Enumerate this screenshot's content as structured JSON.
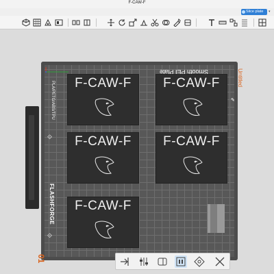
{
  "window": {
    "title": "F-CAW-F"
  },
  "menubar": {
    "slice_label": "Slice plate"
  },
  "plate": {
    "name": "Smooth PEI Plate",
    "material_label": "PLA/PETG/ABS/TPU",
    "brand": "FLASHFORGE",
    "project_name": "Untitled",
    "plate_number": "01"
  },
  "parts": [
    {
      "label": "F-CAW-F"
    },
    {
      "label": "F-CAW-F"
    },
    {
      "label": "F-CAW-F"
    },
    {
      "label": "F-CAW-F"
    },
    {
      "label": "F-CAW-F"
    }
  ],
  "colors": {
    "accent": "#2f7fd6",
    "plate_label": "#d9641f",
    "bed": "#585858"
  }
}
